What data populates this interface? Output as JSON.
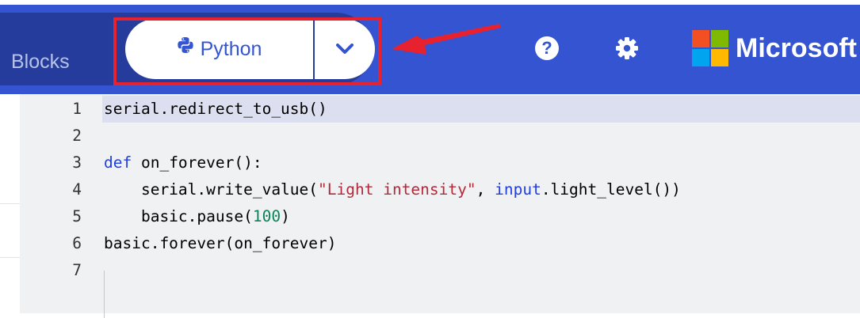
{
  "header": {
    "blocks_label": "Blocks",
    "python_label": "Python",
    "brand_label": "Microsoft",
    "python_icon": "python-logo-icon",
    "dropdown_icon": "chevron-down-icon",
    "help_icon": "help-icon",
    "help_glyph": "?",
    "settings_icon": "gear-icon",
    "annotation": "red-highlight-box-with-arrow",
    "colors": {
      "header_bg": "#3454d1",
      "mode_bg": "#253c9c",
      "highlight": "#e8212f",
      "ms_red": "#f25022",
      "ms_green": "#7fba00",
      "ms_blue": "#00a4ef",
      "ms_yellow": "#ffb900"
    }
  },
  "editor": {
    "active_line": 1,
    "lines": [
      {
        "number": "1",
        "tokens": [
          {
            "text": "serial.redirect_to_usb()",
            "kind": "plain"
          }
        ]
      },
      {
        "number": "2",
        "tokens": []
      },
      {
        "number": "3",
        "tokens": [
          {
            "text": "def",
            "kind": "keyword"
          },
          {
            "text": " on_forever():",
            "kind": "plain"
          }
        ]
      },
      {
        "number": "4",
        "tokens": [
          {
            "text": "    serial.write_value(",
            "kind": "plain"
          },
          {
            "text": "\"Light intensity\"",
            "kind": "string"
          },
          {
            "text": ", ",
            "kind": "plain"
          },
          {
            "text": "input",
            "kind": "keyword"
          },
          {
            "text": ".light_level())",
            "kind": "plain"
          }
        ]
      },
      {
        "number": "5",
        "tokens": [
          {
            "text": "    basic.pause(",
            "kind": "plain"
          },
          {
            "text": "100",
            "kind": "number"
          },
          {
            "text": ")",
            "kind": "plain"
          }
        ]
      },
      {
        "number": "6",
        "tokens": [
          {
            "text": "basic.forever(on_forever)",
            "kind": "plain"
          }
        ]
      },
      {
        "number": "7",
        "tokens": []
      }
    ]
  }
}
